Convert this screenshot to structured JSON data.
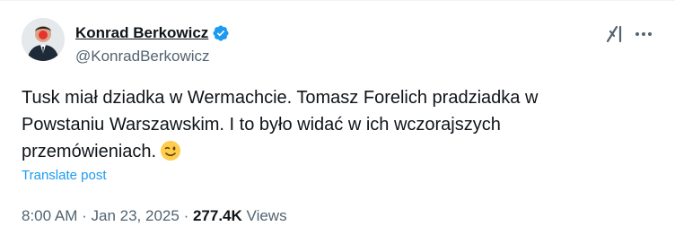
{
  "author": {
    "name": "Konrad Berkowicz",
    "handle": "@KonradBerkowicz",
    "verified": true
  },
  "tweet": {
    "text_line1": "Tusk miał dziadka w Wermachcie. Tomasz Forelich pradziadka w",
    "text_line2": "Powstaniu Warszawskim. I to było widać w ich wczorajszych",
    "text_line3": "przemówieniach.",
    "emoji": "winking-face"
  },
  "translate_label": "Translate post",
  "meta": {
    "time": "8:00 AM",
    "sep1": "·",
    "date": "Jan 23, 2025",
    "sep2": "·",
    "views_count": "277.4K",
    "views_label": "Views"
  },
  "icons": {
    "grok": "grok-icon",
    "more": "more-icon",
    "verified": "verified-badge-icon"
  },
  "colors": {
    "accent": "#1d9bf0",
    "secondary_text": "#536471",
    "primary_text": "#0f1419"
  }
}
